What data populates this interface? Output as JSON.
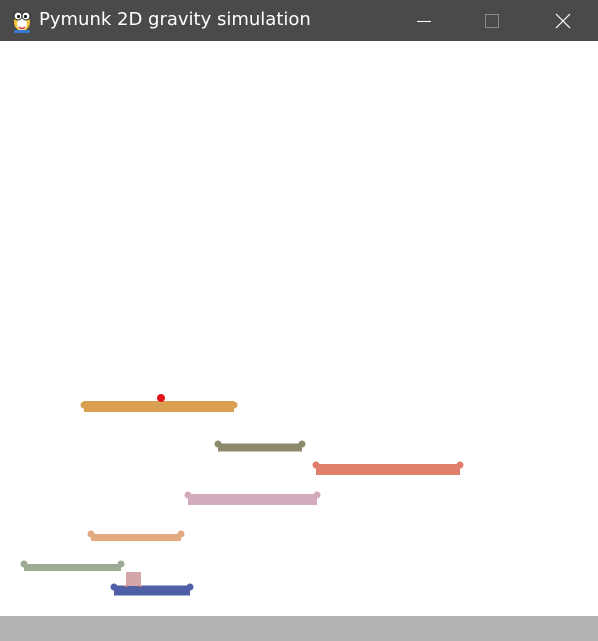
{
  "window": {
    "title": "Pymunk 2D gravity simulation",
    "app_icon": "pygame-snake-icon",
    "titlebar_color": "#4a4a4a",
    "controls": [
      "minimize-icon",
      "maximize-icon",
      "close-icon"
    ]
  },
  "simulation": {
    "background_color": "#ffffff",
    "ground_color": "#b3b3b3",
    "platforms": [
      {
        "name": "platform-orange",
        "color": "#d9a052"
      },
      {
        "name": "platform-olive",
        "color": "#8d8a6b"
      },
      {
        "name": "platform-salmon",
        "color": "#e07f6a"
      },
      {
        "name": "platform-pink",
        "color": "#d4aabd"
      },
      {
        "name": "platform-peach",
        "color": "#e2aa7e"
      },
      {
        "name": "platform-sage",
        "color": "#9dab95"
      },
      {
        "name": "platform-blue",
        "color": "#4e5fa6"
      }
    ],
    "ball_color": "#e0141a",
    "box_color": "#d4a6aa"
  }
}
